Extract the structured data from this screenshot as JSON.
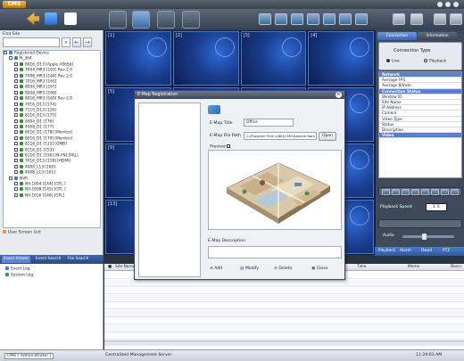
{
  "app": {
    "logo": "CMS"
  },
  "toolbar": {
    "big_buttons": [
      "live-view-icon",
      "playback-icon",
      "emap-icon",
      "settings-icon"
    ],
    "right_buttons": [
      "layout-1-icon",
      "layout-4-icon",
      "layout-9-icon",
      "layout-16-icon",
      "layout-25-icon",
      "layout-36-icon",
      "layout-64-icon",
      "fullscreen-icon"
    ]
  },
  "site": {
    "label": "Find Site",
    "search_placeholder": "",
    "root": "Registered Device",
    "items": [
      "N_364",
      "8016_D13 [Apple A56Sd]",
      "7004_MR3 [163] Rev 2.0",
      "7008_MR3 [164] Rev 2.0",
      "7016_MR3 [165]",
      "8004_MR3 [167]",
      "8008_MR3 [168]",
      "8016_MR3 [169] Rev 2.0",
      "7016_D13 [174]",
      "7116_D13 [126]",
      "8116_D13 [175]",
      "8004_D1 [176]",
      "4008_D1 [177]",
      "8016_D1 [178] [Monitor]",
      "8016_D1 [179] [Monitor]",
      "8116_D1 [112] [GMB]",
      "8116_D1 [153]",
      "8116_D1 [156] [N-FN] [PAL]",
      "7016_D13 [118] [HDMI]",
      "4004_L13 [160]",
      "4008_L13 [161]",
      "NVR",
      "NV-1004 [144] [GTL ]",
      "NV-1008 [145] [GTL ]",
      "NV-1016 [146] [GTL]"
    ],
    "screen_list": "User Screen List"
  },
  "video_cells": [
    "[1]",
    "[2]",
    "[3]",
    "[4]",
    "[5]",
    "",
    "",
    "",
    "[9]",
    "",
    "",
    "",
    "[13]",
    "",
    "",
    ""
  ],
  "right_panel": {
    "tab_connection": "Connection",
    "tab_information": "Information",
    "connection_type": "Connection Type",
    "live": "Live",
    "playback": "Playback",
    "info_rows": [
      {
        "text": "Network",
        "head": true
      },
      {
        "text": "Average FPS",
        "head": false
      },
      {
        "text": "Average Bitrate",
        "head": false
      },
      {
        "text": "Connection Status",
        "head": true
      },
      {
        "text": "Window ID",
        "head": false
      },
      {
        "text": "Site Name",
        "head": false
      },
      {
        "text": "IP Address",
        "head": false
      },
      {
        "text": "Camera",
        "head": false
      },
      {
        "text": "Video Type",
        "head": false
      },
      {
        "text": "Status",
        "head": false
      },
      {
        "text": "Description",
        "head": false
      },
      {
        "text": "Video",
        "head": true
      }
    ],
    "playback_speed": "Playback Speed",
    "speed_value": "1 X",
    "audio": "Audio",
    "bottom_tabs": [
      "Playback",
      "Alarm",
      "Dwell",
      "PTZ"
    ]
  },
  "lower_tabs": [
    "Event Viewer",
    "Event Search",
    "File Search"
  ],
  "event_tree": [
    "Event Log",
    "System Log"
  ],
  "log_headers": [
    "Site Name",
    "Time",
    "Memo",
    "Descr"
  ],
  "status": {
    "user": "CMS [ Administrator ]",
    "center": "Centralized Management Server",
    "time": "11:29:03 AM"
  },
  "dialog": {
    "title": "E-Map Registration",
    "emap_title_label": "E-Map Title",
    "emap_title_value": "Office",
    "file_path_label": "E-Map File Path",
    "file_path_value": "C:\\Program Files (x86)\\CMS\\Sample Bam",
    "open": "Open",
    "preview": "Preview",
    "description_label": "E-Map Description",
    "add": "Add",
    "modify": "Modify",
    "delete": "Delete",
    "close": "Close"
  }
}
